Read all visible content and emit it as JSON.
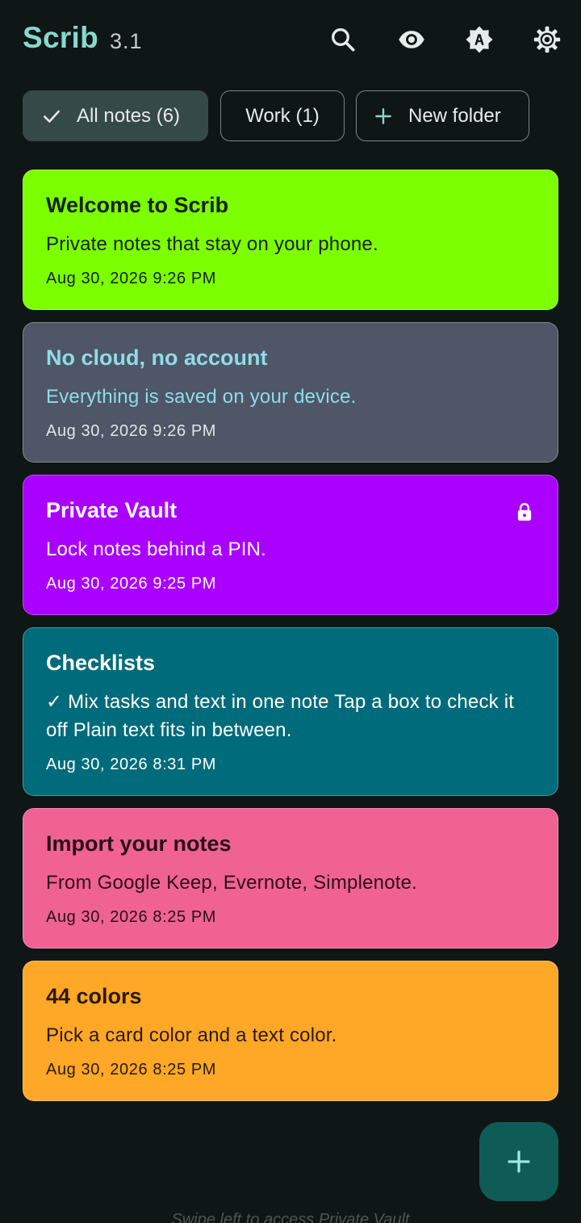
{
  "header": {
    "title": "Scrib",
    "version": "3.1",
    "actions": [
      "search-icon",
      "eye-icon",
      "brightness-auto-icon",
      "gear-icon"
    ],
    "title_color": "#86d9cc"
  },
  "chips": [
    {
      "label": "All notes (6)",
      "selected": true,
      "icon": "check-icon"
    },
    {
      "label": "Work (1)",
      "selected": false
    },
    {
      "label": "New folder",
      "selected": false,
      "icon": "plus-icon"
    }
  ],
  "notes": [
    {
      "title": "Welcome to Scrib",
      "body": "Private notes that stay on your phone.",
      "date": "Aug 30, 2026 9:26 PM",
      "card_color": "#7cff00",
      "text_color": "#142014"
    },
    {
      "title": "No cloud, no account",
      "body": "Everything is saved on your device.",
      "date": "Aug 30, 2026 9:26 PM",
      "card_color": "#4f5668",
      "text_color": "#8fdde5",
      "date_color": "#e2e6ea"
    },
    {
      "title": "Private Vault",
      "body": "Lock notes behind a PIN.",
      "date": "Aug 30, 2026 9:25 PM",
      "card_color": "#aa00ff",
      "text_color": "#ffffff",
      "locked": true
    },
    {
      "title": "Checklists",
      "body": "✓ Mix tasks and text in one note Tap a box to check it off Plain text fits in between.",
      "date": "Aug 30, 2026 8:31 PM",
      "card_color": "#006b7a",
      "text_color": "#ffffff"
    },
    {
      "title": "Import your notes",
      "body": "From Google Keep, Evernote, Simplenote.",
      "date": "Aug 30, 2026 8:25 PM",
      "card_color": "#f06292",
      "text_color": "#2a0f18"
    },
    {
      "title": "44 colors",
      "body": "Pick a card color and a text color.",
      "date": "Aug 30, 2026 8:25 PM",
      "card_color": "#ffa726",
      "text_color": "#2a1a05"
    }
  ],
  "fab": {
    "icon": "plus-icon",
    "color": "#0e5c55"
  },
  "footer_hint": "Swipe left to access Private Vault"
}
